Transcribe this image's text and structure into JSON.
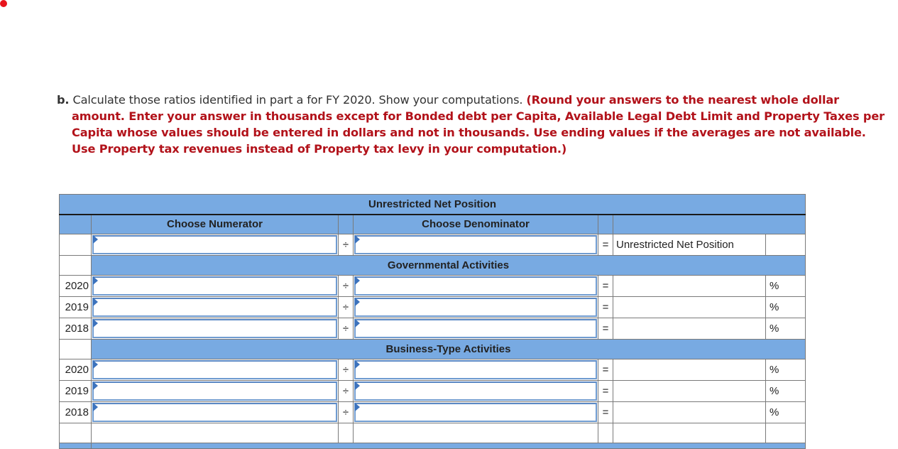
{
  "instructions": {
    "part_label": "b.",
    "text": "Calculate those ratios identified in part a for FY 2020. Show your computations.",
    "hint": "(Round your answers to the nearest whole dollar amount. Enter your answer in thousands except for Bonded debt per Capita, Available Legal Debt Limit and Property Taxes per Capita whose values should be entered in dollars and not in thousands. Use ending values if the averages are not available. Use Property tax revenues instead of Property tax levy in your computation.)"
  },
  "table": {
    "title": "Unrestricted Net Position",
    "numerator_header": "Choose Numerator",
    "denominator_header": "Choose Denominator",
    "divide_symbol": "÷",
    "equals_symbol": "=",
    "formula_row": {
      "numerator_value": "",
      "denominator_value": "",
      "result_label": "Unrestricted Net Position"
    },
    "sections": [
      {
        "title": "Governmental Activities",
        "rows": [
          {
            "year": "2020",
            "numerator": "",
            "denominator": "",
            "result": "",
            "unit": "%"
          },
          {
            "year": "2019",
            "numerator": "",
            "denominator": "",
            "result": "",
            "unit": "%"
          },
          {
            "year": "2018",
            "numerator": "",
            "denominator": "",
            "result": "",
            "unit": "%"
          }
        ]
      },
      {
        "title": "Business-Type Activities",
        "rows": [
          {
            "year": "2020",
            "numerator": "",
            "denominator": "",
            "result": "",
            "unit": "%"
          },
          {
            "year": "2019",
            "numerator": "",
            "denominator": "",
            "result": "",
            "unit": "%"
          },
          {
            "year": "2018",
            "numerator": "",
            "denominator": "",
            "result": "",
            "unit": "%"
          }
        ]
      }
    ]
  },
  "colors": {
    "header_blue": "#78aae2",
    "hint_red": "#b2121a",
    "flag_blue": "#3d73bd",
    "record_dot": "#e8141b"
  }
}
